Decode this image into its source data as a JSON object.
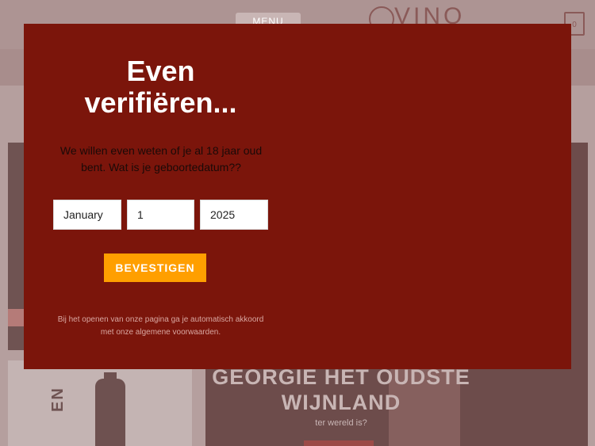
{
  "background": {
    "header": {
      "menu_label": "MENU",
      "logo_text": "VINO",
      "cart_count": "0"
    },
    "feature": {
      "title": "GEORGIE HET OUDSTE WIJNLAND",
      "subtitle": "ter wereld is?"
    },
    "vertical_text": "EN"
  },
  "modal": {
    "title": "Even verifiëren...",
    "question": "We willen even weten of je al 18 jaar oud bent. Wat is je geboortedatum??",
    "month_value": "January",
    "day_value": "1",
    "year_value": "2025",
    "confirm_label": "BEVESTIGEN",
    "disclaimer": "Bij het openen van onze pagina ga je automatisch akkoord met onze algemene voorwaarden."
  },
  "colors": {
    "modal_bg": "#7b150b",
    "button_bg": "#ff9f00",
    "overlay_tint": "#b59f9e"
  }
}
